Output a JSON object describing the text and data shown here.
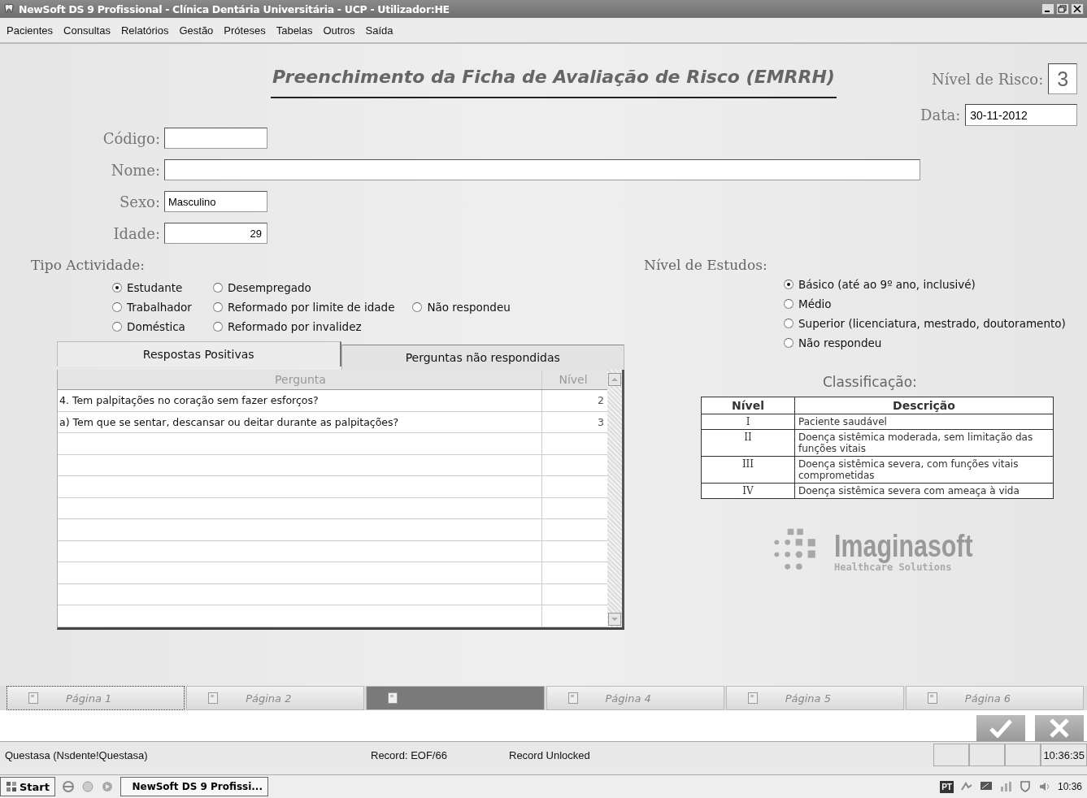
{
  "window": {
    "title": "NewSoft DS 9 Profissional  - Clínica Dentária Universitária - UCP - Utilizador:HE"
  },
  "menu": [
    "Pacientes",
    "Consultas",
    "Relatórios",
    "Gestão",
    "Próteses",
    "Tabelas",
    "Outros",
    "Saída"
  ],
  "heading": "Preenchimento da Ficha de Avaliação de Risco (EMRRH)",
  "risk": {
    "label": "Nível de Risco:",
    "value": "3"
  },
  "date": {
    "label": "Data:",
    "value": "30-11-2012"
  },
  "fields": [
    {
      "label": "Código:",
      "kind": "short"
    },
    {
      "label": "Nome:",
      "kind": "long"
    },
    {
      "label": "Sexo:",
      "value": "Masculino",
      "kind": "short"
    },
    {
      "label": "Idade:",
      "value": "29",
      "kind": "number"
    }
  ],
  "activity": {
    "label": "Tipo Actividade:",
    "columns": [
      [
        {
          "label": "Estudante",
          "selected": true
        },
        {
          "label": "Trabalhador",
          "selected": false
        },
        {
          "label": "Doméstica",
          "selected": false
        }
      ],
      [
        {
          "label": "Desempregado",
          "selected": false
        },
        {
          "label": "Reformado por limite de idade",
          "selected": false
        },
        {
          "label": "Reformado por invalidez",
          "selected": false
        }
      ],
      [
        {
          "label": "Não respondeu",
          "selected": false
        }
      ]
    ]
  },
  "education": {
    "label": "Nível de Estudos:",
    "options": [
      {
        "label": "Básico (até ao 9º ano, inclusivé)",
        "selected": true
      },
      {
        "label": "Médio",
        "selected": false
      },
      {
        "label": "Superior (licenciatura, mestrado, doutoramento)",
        "selected": false
      },
      {
        "label": "Não respondeu",
        "selected": false
      }
    ]
  },
  "answer_tabs": [
    {
      "label": "Respostas Positivas",
      "selected": true
    },
    {
      "label": "Perguntas não respondidas",
      "selected": false
    }
  ],
  "answers": {
    "columns": [
      "Pergunta",
      "Nível"
    ],
    "rows": [
      [
        "4. Tem palpitações no coração sem fazer esforços?",
        "2"
      ],
      [
        "a) Tem que se sentar, descansar ou deitar durante as palpitações?",
        "3"
      ]
    ]
  },
  "classification": {
    "title": "Classificação:",
    "columns": [
      "Nível",
      "Descrição"
    ],
    "rows": [
      [
        "I",
        "Paciente saudável"
      ],
      [
        "II",
        "Doença sistêmica moderada, sem limitação das funções vitais"
      ],
      [
        "III",
        "Doença sistêmica severa, com funções vitais comprometidas"
      ],
      [
        "IV",
        "Doença sistêmica severa com ameaça à vida"
      ]
    ]
  },
  "logo": {
    "name": "Imaginasoft",
    "tagline": "Healthcare Solutions"
  },
  "pages": [
    {
      "label": "Página 1",
      "selected": false
    },
    {
      "label": "Página 2",
      "selected": false
    },
    {
      "selected": true
    },
    {
      "label": "Página 4",
      "selected": false
    },
    {
      "label": "Página 5",
      "selected": false
    },
    {
      "label": "Página 6",
      "selected": false
    }
  ],
  "status_bar": {
    "database": "Questasa (Nsdente!Questasa)",
    "record": "Record: EOF/66",
    "lock": "Record Unlocked",
    "time": "10:36:35"
  },
  "taskbar": {
    "start": "Start",
    "task": "NewSoft DS 9 Profissi...",
    "language": "PT",
    "clock": "10:36"
  }
}
